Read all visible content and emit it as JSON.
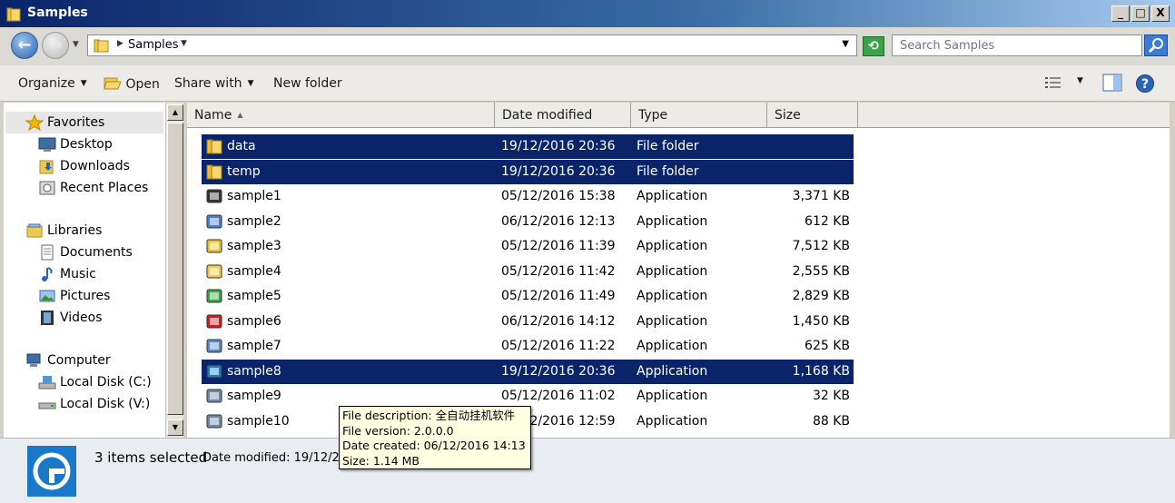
{
  "window": {
    "title": "Samples",
    "minimize": "_",
    "maximize": "□",
    "close": "X"
  },
  "address": {
    "crumb": "Samples",
    "search_placeholder": "Search Samples"
  },
  "toolbar": {
    "organize": "Organize",
    "open": "Open",
    "share_with": "Share with",
    "new_folder": "New folder"
  },
  "nav": {
    "favorites": "Favorites",
    "favorites_items": [
      "Desktop",
      "Downloads",
      "Recent Places"
    ],
    "libraries": "Libraries",
    "libraries_items": [
      "Documents",
      "Music",
      "Pictures",
      "Videos"
    ],
    "computer": "Computer",
    "computer_items": [
      "Local Disk (C:)",
      "Local Disk (V:)"
    ]
  },
  "columns": {
    "name": "Name",
    "date": "Date modified",
    "type": "Type",
    "size": "Size"
  },
  "files": [
    {
      "name": "data",
      "date": "19/12/2016 20:36",
      "type": "File folder",
      "size": "",
      "selected": true
    },
    {
      "name": "temp",
      "date": "19/12/2016 20:36",
      "type": "File folder",
      "size": "",
      "selected": true
    },
    {
      "name": "sample1",
      "date": "05/12/2016 15:38",
      "type": "Application",
      "size": "3,371 KB",
      "selected": false
    },
    {
      "name": "sample2",
      "date": "06/12/2016 12:13",
      "type": "Application",
      "size": "612 KB",
      "selected": false
    },
    {
      "name": "sample3",
      "date": "05/12/2016 11:39",
      "type": "Application",
      "size": "7,512 KB",
      "selected": false
    },
    {
      "name": "sample4",
      "date": "05/12/2016 11:42",
      "type": "Application",
      "size": "2,555 KB",
      "selected": false
    },
    {
      "name": "sample5",
      "date": "05/12/2016 11:49",
      "type": "Application",
      "size": "2,829 KB",
      "selected": false
    },
    {
      "name": "sample6",
      "date": "06/12/2016 14:12",
      "type": "Application",
      "size": "1,450 KB",
      "selected": false
    },
    {
      "name": "sample7",
      "date": "05/12/2016 11:22",
      "type": "Application",
      "size": "625 KB",
      "selected": false
    },
    {
      "name": "sample8",
      "date": "19/12/2016 20:36",
      "type": "Application",
      "size": "1,168 KB",
      "selected": true
    },
    {
      "name": "sample9",
      "date": "05/12/2016 11:02",
      "type": "Application",
      "size": "32 KB",
      "selected": false
    },
    {
      "name": "sample10",
      "date": "06/12/2016 12:59",
      "type": "Application",
      "size": "88 KB",
      "selected": false
    }
  ],
  "tooltip": {
    "description": "File description: 全自动挂机软件",
    "version": "File version: 2.0.0.0",
    "created": "Date created: 06/12/2016 14:13",
    "size": "Size: 1.14 MB"
  },
  "status": {
    "selected": "3 items selected",
    "date_modified": "Date modified: 19/12/2016 20:36"
  },
  "colors": {
    "selection": "#0a246a",
    "title_start": "#0a246a",
    "tooltip_bg": "#ffffe1"
  }
}
